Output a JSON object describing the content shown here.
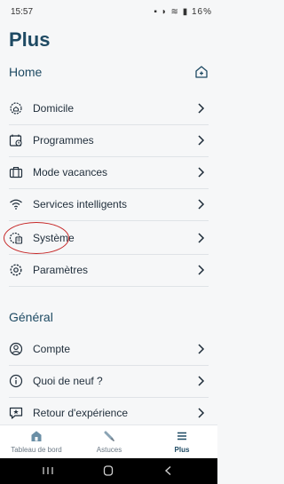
{
  "status": {
    "time": "15:57",
    "battery": "16%"
  },
  "page": {
    "title": "Plus"
  },
  "home": {
    "title": "Home",
    "items": [
      {
        "label": "Domicile",
        "icon": "gear-house-icon"
      },
      {
        "label": "Programmes",
        "icon": "calendar-clock-icon"
      },
      {
        "label": "Mode vacances",
        "icon": "suitcase-icon"
      },
      {
        "label": "Services intelligents",
        "icon": "wifi-icon"
      },
      {
        "label": "Système",
        "icon": "gear-device-icon"
      },
      {
        "label": "Paramètres",
        "icon": "gear-icon"
      }
    ]
  },
  "general": {
    "title": "Général",
    "items": [
      {
        "label": "Compte",
        "icon": "user-icon"
      },
      {
        "label": "Quoi de neuf ?",
        "icon": "info-icon"
      },
      {
        "label": "Retour d'expérience",
        "icon": "feedback-icon"
      }
    ]
  },
  "tabs": [
    {
      "label": "Tableau de bord",
      "icon": "house-icon",
      "active": false
    },
    {
      "label": "Astuces",
      "icon": "bulb-icon",
      "active": false
    },
    {
      "label": "Plus",
      "icon": "menu-icon",
      "active": true
    }
  ],
  "colors": {
    "accent": "#1e4a63",
    "highlight": "#c62828"
  }
}
